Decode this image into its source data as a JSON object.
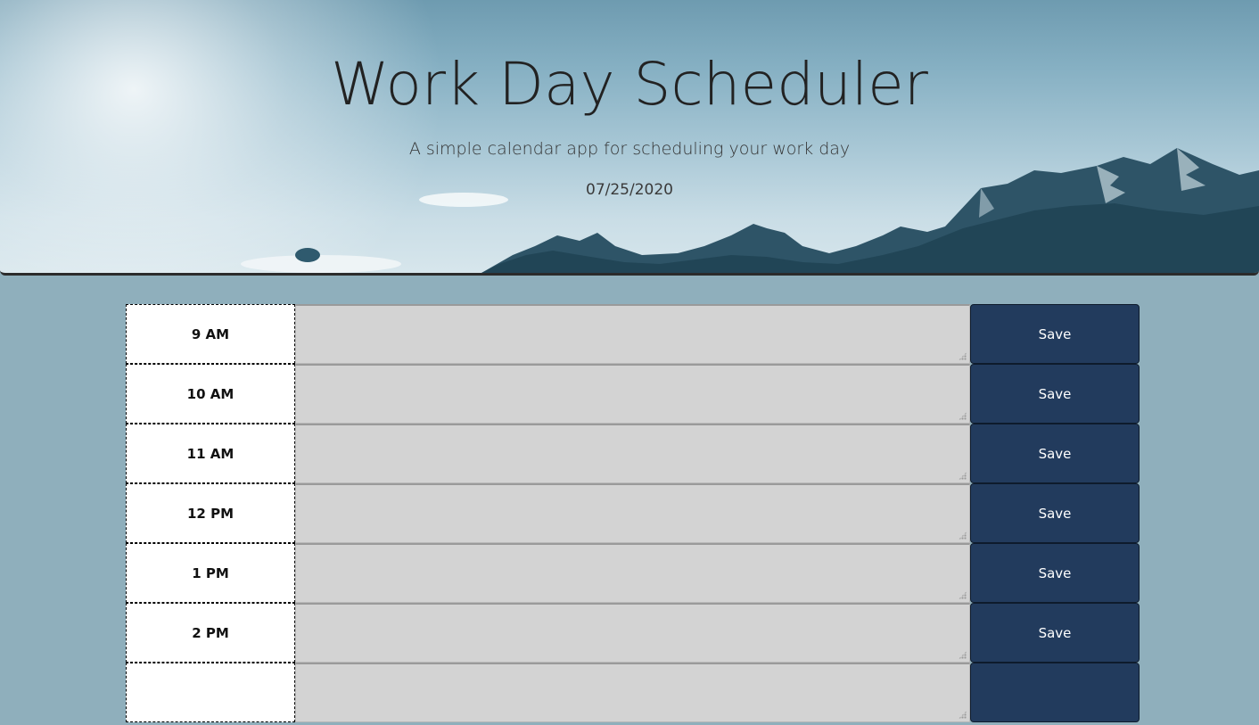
{
  "header": {
    "title": "Work Day Scheduler",
    "subtitle": "A simple calendar app for scheduling your work day",
    "current_date": "07/25/2020"
  },
  "schedule": {
    "rows": [
      {
        "hour": "9 AM",
        "task": "",
        "save_label": "Save"
      },
      {
        "hour": "10 AM",
        "task": "",
        "save_label": "Save"
      },
      {
        "hour": "11 AM",
        "task": "",
        "save_label": "Save"
      },
      {
        "hour": "12 PM",
        "task": "",
        "save_label": "Save"
      },
      {
        "hour": "1 PM",
        "task": "",
        "save_label": "Save"
      },
      {
        "hour": "2 PM",
        "task": "",
        "save_label": "Save"
      },
      {
        "hour": "",
        "task": "",
        "save_label": ""
      }
    ]
  },
  "colors": {
    "background": "#8fafbc",
    "past_block": "#d3d3d3",
    "save_button": "#223b5d",
    "hour_block": "#ffffff"
  }
}
